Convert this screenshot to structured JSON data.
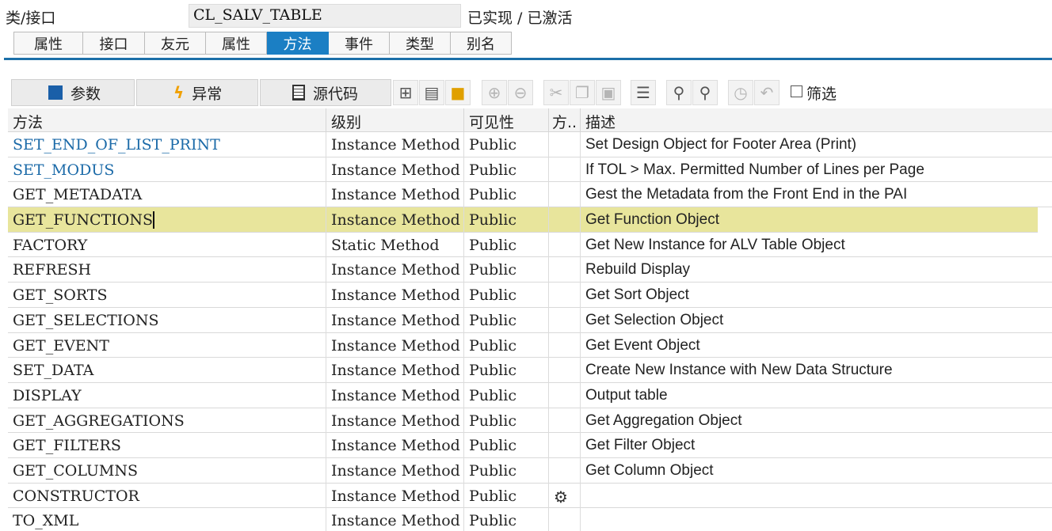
{
  "header": {
    "label": "类/接口",
    "class_name": "CL_SALV_TABLE",
    "status": "已实现 / 已激活"
  },
  "tabs": [
    {
      "label": "属性",
      "active": false
    },
    {
      "label": "接口",
      "active": false
    },
    {
      "label": "友元",
      "active": false
    },
    {
      "label": "属性",
      "active": false
    },
    {
      "label": "方法",
      "active": true
    },
    {
      "label": "事件",
      "active": false
    },
    {
      "label": "类型",
      "active": false
    },
    {
      "label": "别名",
      "active": false
    }
  ],
  "toolbar": {
    "params_label": "参数",
    "exceptions_label": "异常",
    "source_label": "源代码",
    "filter_label": "筛选",
    "icons": [
      "tree-icon",
      "display-icon",
      "navigate-icon",
      "insert-row-icon",
      "delete-row-icon",
      "cut-icon",
      "copy-icon",
      "paste-icon",
      "sort-icon",
      "find-icon",
      "find-next-icon",
      "clock-icon",
      "undo-icon"
    ]
  },
  "columns": {
    "method": "方法",
    "level": "级别",
    "visibility": "可见性",
    "mode": "方..",
    "description": "描述"
  },
  "rows": [
    {
      "method": "SET_END_OF_LIST_PRINT",
      "level": "Instance Method",
      "visibility": "Public",
      "mode": "",
      "description": "Set Design Object for Footer Area (Print)",
      "link": true
    },
    {
      "method": "SET_MODUS",
      "level": "Instance Method",
      "visibility": "Public",
      "mode": "",
      "description": "If TOL > Max. Permitted Number of Lines per Page",
      "link": true
    },
    {
      "method": "GET_METADATA",
      "level": "Instance Method",
      "visibility": "Public",
      "mode": "",
      "description": "Gest the Metadata from the Front End in the PAI"
    },
    {
      "method": "GET_FUNCTIONS",
      "level": "Instance Method",
      "visibility": "Public",
      "mode": "",
      "description": "Get Function Object",
      "selected": true
    },
    {
      "method": "FACTORY",
      "level": "Static Method",
      "visibility": "Public",
      "mode": "",
      "description": "Get New Instance for ALV Table Object"
    },
    {
      "method": "REFRESH",
      "level": "Instance Method",
      "visibility": "Public",
      "mode": "",
      "description": "Rebuild Display"
    },
    {
      "method": "GET_SORTS",
      "level": "Instance Method",
      "visibility": "Public",
      "mode": "",
      "description": "Get Sort Object"
    },
    {
      "method": "GET_SELECTIONS",
      "level": "Instance Method",
      "visibility": "Public",
      "mode": "",
      "description": "Get Selection Object"
    },
    {
      "method": "GET_EVENT",
      "level": "Instance Method",
      "visibility": "Public",
      "mode": "",
      "description": "Get Event Object"
    },
    {
      "method": "SET_DATA",
      "level": "Instance Method",
      "visibility": "Public",
      "mode": "",
      "description": "Create New Instance with New Data Structure"
    },
    {
      "method": "DISPLAY",
      "level": "Instance Method",
      "visibility": "Public",
      "mode": "",
      "description": "Output table"
    },
    {
      "method": "GET_AGGREGATIONS",
      "level": "Instance Method",
      "visibility": "Public",
      "mode": "",
      "description": "Get Aggregation Object"
    },
    {
      "method": "GET_FILTERS",
      "level": "Instance Method",
      "visibility": "Public",
      "mode": "",
      "description": "Get Filter Object"
    },
    {
      "method": "GET_COLUMNS",
      "level": "Instance Method",
      "visibility": "Public",
      "mode": "",
      "description": "Get Column Object"
    },
    {
      "method": "CONSTRUCTOR",
      "level": "Instance Method",
      "visibility": "Public",
      "mode": "wrench-icon",
      "description": ""
    },
    {
      "method": "TO_XML",
      "level": "Instance Method",
      "visibility": "Public",
      "mode": "",
      "description": ""
    }
  ]
}
